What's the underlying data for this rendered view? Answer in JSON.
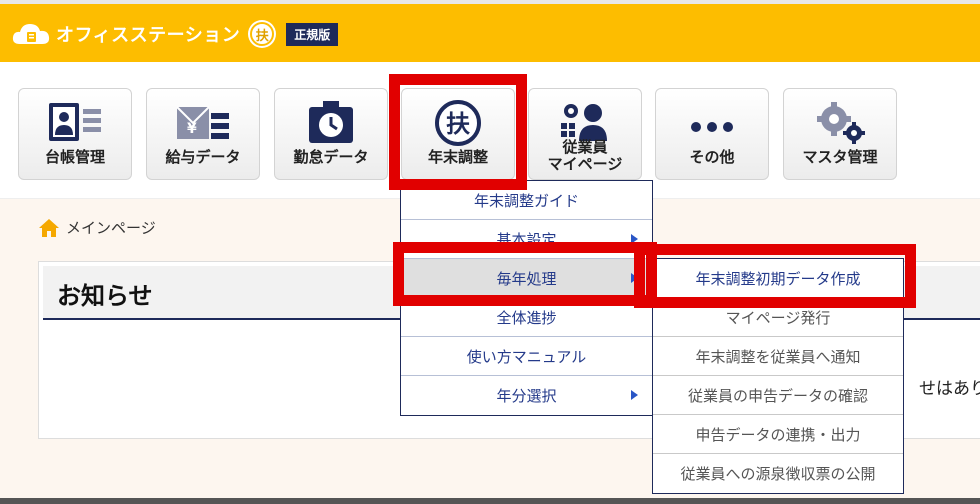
{
  "header": {
    "app_name": "オフィスステーション",
    "badge_char": "扶",
    "edition": "正規版"
  },
  "nav": {
    "tiles": [
      {
        "label": "台帳管理",
        "icon": "ledger-icon"
      },
      {
        "label": "給与データ",
        "icon": "payroll-icon"
      },
      {
        "label": "勤怠データ",
        "icon": "attendance-icon"
      },
      {
        "label": "年末調整",
        "icon": "year-end-adjustment-icon",
        "badge": "扶"
      },
      {
        "label": "従業員",
        "label2": "マイページ",
        "icon": "employee-mypage-icon",
        "top_text": "従業員"
      },
      {
        "label": "その他",
        "icon": "more-icon"
      },
      {
        "label": "マスタ管理",
        "icon": "master-settings-icon"
      }
    ]
  },
  "breadcrumb": {
    "label": "メインページ"
  },
  "notice": {
    "title": "お知らせ",
    "body_fragment": "せはあり"
  },
  "menu": {
    "items": [
      {
        "label": "年末調整ガイド",
        "has_submenu": false
      },
      {
        "label": "基本設定",
        "has_submenu": true
      },
      {
        "label": "毎年処理",
        "has_submenu": true,
        "active": true
      },
      {
        "label": "全体進捗",
        "has_submenu": false
      },
      {
        "label": "使い方マニュアル",
        "has_submenu": false
      },
      {
        "label": "年分選択",
        "has_submenu": true
      }
    ]
  },
  "submenu": {
    "items": [
      {
        "label": "年末調整初期データ作成"
      },
      {
        "label": "マイページ発行"
      },
      {
        "label": "年末調整を従業員へ通知"
      },
      {
        "label": "従業員の申告データの確認"
      },
      {
        "label": "申告データの連携・出力"
      },
      {
        "label": "従業員への源泉徴収票の公開"
      }
    ]
  },
  "colors": {
    "header_bg": "#fdbd00",
    "highlight": "#e10000",
    "navy": "#1e2a5a",
    "menu_text": "#243a8a"
  }
}
